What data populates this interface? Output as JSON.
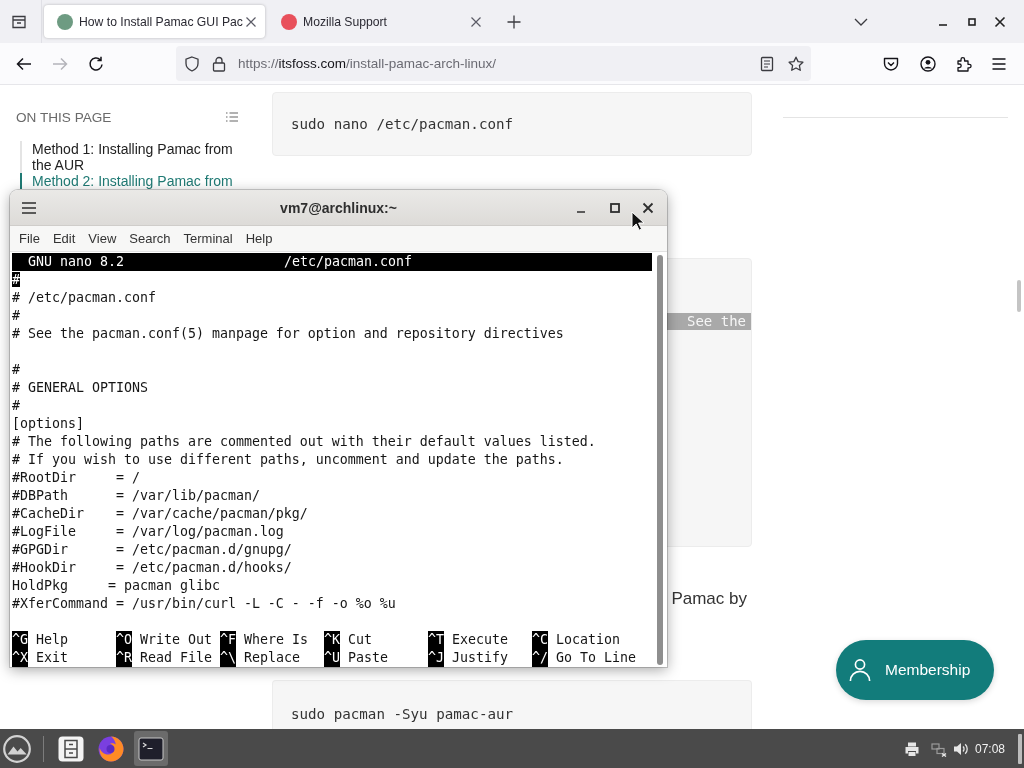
{
  "browser": {
    "tabs": [
      {
        "title": "How to Install Pamac GUI Pac",
        "selected": true,
        "color": "#6e9b82"
      },
      {
        "title": "Mozilla Support",
        "selected": false,
        "color": "#e8505b"
      }
    ],
    "forward_enabled": false,
    "url": {
      "scheme": "https://",
      "host": "itsfoss.com",
      "path": "/install-pamac-arch-linux/"
    }
  },
  "page": {
    "toc": {
      "heading": "ON THIS PAGE",
      "items": [
        {
          "label": "Method 1: Installing Pamac from the AUR",
          "selected": false
        },
        {
          "label": "Method 2: Installing Pamac from",
          "selected": true
        }
      ]
    },
    "article": [
      {
        "kind": "code",
        "text": "sudo nano /etc/pacman.conf"
      },
      {
        "kind": "code_highlight",
        "text": "See the"
      },
      {
        "kind": "paragraph",
        "text": "Pamac by"
      },
      {
        "kind": "code",
        "text": "sudo pacman -Syu pamac-aur"
      }
    ],
    "membership_button": "Membership"
  },
  "terminal": {
    "title": "vm7@archlinux:~",
    "menu": [
      "File",
      "Edit",
      "View",
      "Search",
      "Terminal",
      "Help"
    ],
    "nano": {
      "app": "GNU nano 8.2",
      "file": "/etc/pacman.conf",
      "cursor_at_start": true,
      "blocks": [
        [
          "#",
          "# /etc/pacman.conf",
          "#",
          "# See the pacman.conf(5) manpage for option and repository directives"
        ],
        [
          "#",
          "# GENERAL OPTIONS",
          "#",
          "[options]",
          "# The following paths are commented out with their default values listed.",
          "# If you wish to use different paths, uncomment and update the paths.",
          "#RootDir     = /",
          "#DBPath      = /var/lib/pacman/",
          "#CacheDir    = /var/cache/pacman/pkg/",
          "#LogFile     = /var/log/pacman.log",
          "#GPGDir      = /etc/pacman.d/gnupg/",
          "#HookDir     = /etc/pacman.d/hooks/",
          "HoldPkg     = pacman glibc",
          "#XferCommand = /usr/bin/curl -L -C - -f -o %o %u"
        ]
      ],
      "shortcuts": [
        {
          "key": "^G",
          "label": "Help"
        },
        {
          "key": "^O",
          "label": "Write Out"
        },
        {
          "key": "^F",
          "label": "Where Is"
        },
        {
          "key": "^K",
          "label": "Cut"
        },
        {
          "key": "^T",
          "label": "Execute"
        },
        {
          "key": "^C",
          "label": "Location"
        },
        {
          "key": "^X",
          "label": "Exit"
        },
        {
          "key": "^R",
          "label": "Read File"
        },
        {
          "key": "^\\",
          "label": "Replace"
        },
        {
          "key": "^U",
          "label": "Paste"
        },
        {
          "key": "^J",
          "label": "Justify"
        },
        {
          "key": "^/",
          "label": "Go To Line"
        }
      ]
    }
  },
  "taskbar": {
    "apps": [
      {
        "kind": "files",
        "selected": false
      },
      {
        "kind": "browser",
        "selected": false
      },
      {
        "kind": "terminal",
        "selected": true
      }
    ],
    "clock": "07:08"
  }
}
